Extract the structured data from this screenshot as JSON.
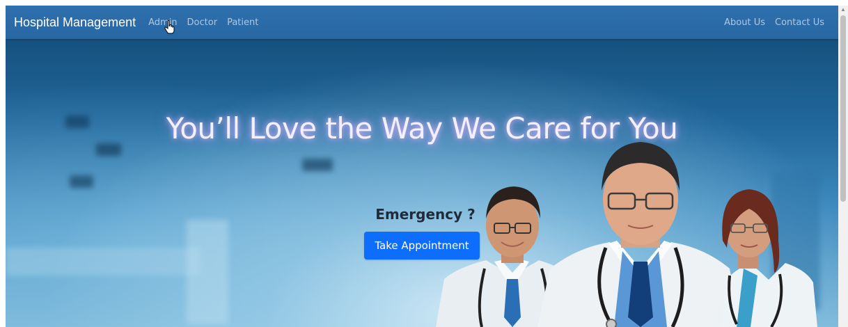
{
  "navbar": {
    "brand": "Hospital Management",
    "left_links": [
      "Admin",
      "Doctor",
      "Patient"
    ],
    "right_links": [
      "About Us",
      "Contact Us"
    ],
    "background": "#2e70ad"
  },
  "hero": {
    "headline": "You’ll Love the Way We Care for You",
    "emergency_text": "Emergency ?",
    "appointment_button": "Take Appointment",
    "button_color": "#0d6efd",
    "image_description_icon": "doctors-photo"
  }
}
